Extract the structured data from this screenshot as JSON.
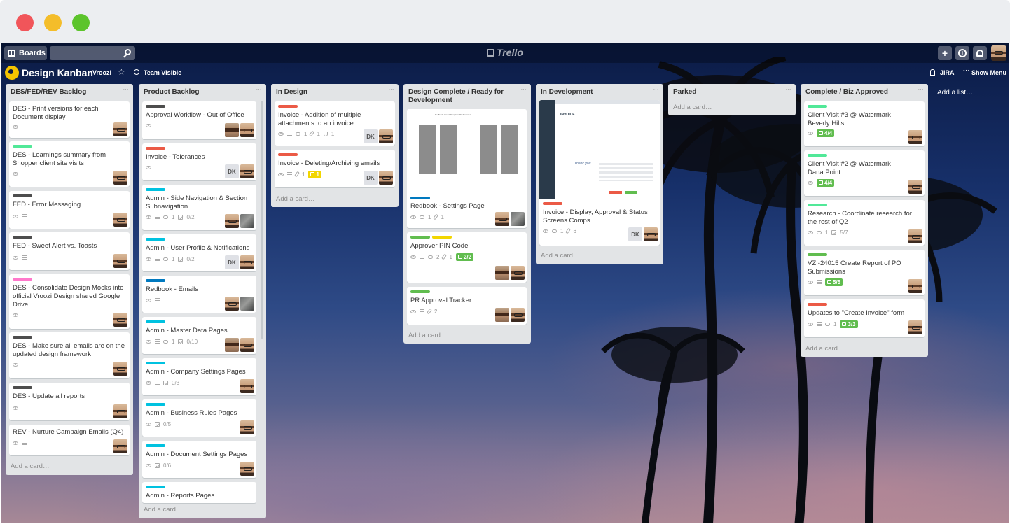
{
  "app": {
    "boards_label": "Boards",
    "logo_text": "Trello",
    "board_title": "Design Kanban",
    "team": "Vroozi",
    "visibility": "Team Visible",
    "jira_label": "JIRA",
    "show_menu": "Show Menu",
    "add_list": "Add a list…",
    "add_card": "Add a card…",
    "plus_label": "+",
    "info_label": "i"
  },
  "colors": {
    "green": "#61bd4f",
    "mint": "#51e898",
    "red": "#eb5a46",
    "cyan": "#00c2e0",
    "blue": "#0079bf",
    "yellow": "#f2d600",
    "pink": "#ff78cb",
    "black": "#4d4d4d"
  },
  "lists": [
    {
      "title": "DES/FED/REV Backlog",
      "cards": [
        {
          "title": "DES - Print versions for each Document display",
          "labels": [],
          "badges": {
            "watch": true
          },
          "members": [
            "a"
          ]
        },
        {
          "title": "DES - Learnings summary from Shopper client site visits",
          "labels": [
            "mint"
          ],
          "badges": {
            "watch": true
          },
          "members": [
            "a"
          ]
        },
        {
          "title": "FED - Error Messaging",
          "labels": [
            "black"
          ],
          "badges": {
            "watch": true,
            "desc": true
          },
          "members": [
            "a"
          ]
        },
        {
          "title": "FED - Sweet Alert vs. Toasts",
          "labels": [
            "black"
          ],
          "badges": {
            "watch": true,
            "desc": true
          },
          "members": [
            "a"
          ]
        },
        {
          "title": "DES - Consolidate Design Mocks into official Vroozi Design shared Google Drive",
          "labels": [
            "pink"
          ],
          "badges": {
            "watch": true
          },
          "members": [
            "a"
          ]
        },
        {
          "title": "DES - Make sure all emails are on the updated design framework",
          "labels": [
            "black"
          ],
          "badges": {
            "watch": true
          },
          "members": [
            "a"
          ]
        },
        {
          "title": "DES - Update all reports",
          "labels": [
            "black"
          ],
          "badges": {
            "watch": true
          },
          "members": [
            "a"
          ]
        },
        {
          "title": "REV - Nurture Campaign Emails (Q4)",
          "labels": [],
          "badges": {
            "watch": true,
            "desc": true
          },
          "members": [
            "a"
          ]
        }
      ]
    },
    {
      "title": "Product Backlog",
      "cards": [
        {
          "title": "Approval Workflow - Out of Office",
          "labels": [
            "black"
          ],
          "badges": {
            "watch": true
          },
          "members": [
            "b",
            "a"
          ]
        },
        {
          "title": "Invoice - Tolerances",
          "labels": [
            "red"
          ],
          "badges": {
            "watch": true
          },
          "members": [
            "dk",
            "a"
          ]
        },
        {
          "title": "Admin - Side Navigation & Section Subnavigation",
          "labels": [
            "cyan"
          ],
          "badges": {
            "watch": true,
            "desc": true,
            "comments": "1",
            "checklist": "0/2"
          },
          "members": [
            "a",
            "c"
          ]
        },
        {
          "title": "Admin - User Profile & Notifications",
          "labels": [
            "cyan"
          ],
          "badges": {
            "watch": true,
            "desc": true,
            "comments": "1",
            "checklist": "0/2"
          },
          "members": [
            "dk",
            "a"
          ]
        },
        {
          "title": "Redbook - Emails",
          "labels": [
            "blue"
          ],
          "badges": {
            "watch": true,
            "desc": true
          },
          "members": [
            "a",
            "c"
          ]
        },
        {
          "title": "Admin - Master Data Pages",
          "labels": [
            "cyan"
          ],
          "badges": {
            "watch": true,
            "desc": true,
            "comments": "1",
            "checklist": "0/10"
          },
          "members": [
            "b",
            "a"
          ]
        },
        {
          "title": "Admin - Company Settings Pages",
          "labels": [
            "cyan"
          ],
          "badges": {
            "watch": true,
            "desc": true,
            "checklist": "0/3"
          },
          "members": [
            "a"
          ]
        },
        {
          "title": "Admin - Business Rules Pages",
          "labels": [
            "cyan"
          ],
          "badges": {
            "watch": true,
            "checklist": "0/5"
          },
          "members": [
            "a"
          ]
        },
        {
          "title": "Admin - Document Settings Pages",
          "labels": [
            "cyan"
          ],
          "badges": {
            "watch": true,
            "checklist": "0/6"
          },
          "members": [
            "a"
          ]
        },
        {
          "title": "Admin - Reports Pages",
          "labels": [
            "cyan"
          ],
          "badges": {},
          "members": []
        }
      ]
    },
    {
      "title": "In Design",
      "cards": [
        {
          "title": "Invoice - Addition of multiple attachments to an invoice",
          "labels": [
            "red"
          ],
          "badges": {
            "watch": true,
            "desc": true,
            "comments": "1",
            "attachments": "1",
            "trophy": "1"
          },
          "members": [
            "dk",
            "a"
          ]
        },
        {
          "title": "Invoice - Deleting/Archiving emails",
          "labels": [
            "red"
          ],
          "badges": {
            "watch": true,
            "desc": true,
            "attachments": "1",
            "trophy_yellow": "1"
          },
          "members": [
            "dk",
            "a"
          ]
        }
      ]
    },
    {
      "title": "Design Complete / Ready for Development",
      "cards": [
        {
          "title": "Redbook - Settings Page",
          "labels": [
            "blue"
          ],
          "badges": {
            "watch": true,
            "comments": "1",
            "attachments": "1"
          },
          "members": [
            "a",
            "c"
          ],
          "cover_title": "Redbook Vroozi Template Preferences"
        },
        {
          "title": "Approver PIN Code",
          "labels": [
            "green",
            "yellow"
          ],
          "badges": {
            "watch": true,
            "desc": true,
            "comments": "2",
            "attachments": "1",
            "checklist_done": "2/2"
          },
          "members": [
            "b",
            "a"
          ]
        },
        {
          "title": "PR Approval Tracker",
          "labels": [
            "green"
          ],
          "badges": {
            "watch": true,
            "desc": true,
            "attachments": "2"
          },
          "members": [
            "b",
            "a"
          ]
        }
      ]
    },
    {
      "title": "In Development",
      "cards": [
        {
          "title": "Invoice - Display, Approval & Status Screens Comps",
          "labels": [
            "red"
          ],
          "badges": {
            "watch": true,
            "comments": "1",
            "attachments": "6"
          },
          "members": [
            "dk",
            "a"
          ],
          "cover_title": "INVOICE",
          "cover_note": "Thank you"
        }
      ]
    },
    {
      "title": "Parked",
      "cards": []
    },
    {
      "title": "Complete / Biz Approved",
      "cards": [
        {
          "title": "Client Visit #3 @ Watermark Beverly Hills",
          "labels": [
            "mint"
          ],
          "badges": {
            "watch": true,
            "checklist_done": "4/4"
          },
          "members": [
            "a"
          ]
        },
        {
          "title": "Client Visit #2 @ Watermark Dana Point",
          "labels": [
            "mint"
          ],
          "badges": {
            "watch": true,
            "checklist_done": "4/4"
          },
          "members": [
            "a"
          ]
        },
        {
          "title": "Research - Coordinate research for the rest of Q2",
          "labels": [
            "mint"
          ],
          "badges": {
            "watch": true,
            "comments": "1",
            "checklist": "5/7"
          },
          "members": [
            "a"
          ]
        },
        {
          "title": "VZI-24015 Create Report of PO Submissions",
          "labels": [
            "green"
          ],
          "badges": {
            "watch": true,
            "desc": true,
            "checklist_done": "5/5"
          },
          "members": [
            "a"
          ]
        },
        {
          "title": "Updates to \"Create Invoice\" form",
          "labels": [
            "red"
          ],
          "badges": {
            "watch": true,
            "desc": true,
            "comments": "1",
            "checklist_done": "3/3"
          },
          "members": [
            "a"
          ]
        }
      ]
    }
  ],
  "members_legend": {
    "dk": "DK"
  },
  "icons": {
    "boards": "boards-icon",
    "search": "search-icon",
    "plus": "plus-icon",
    "info": "info-icon",
    "bell": "bell-icon",
    "star": "star-icon",
    "team": "team-icon",
    "jira": "jira-icon",
    "menu": "dots-icon"
  }
}
